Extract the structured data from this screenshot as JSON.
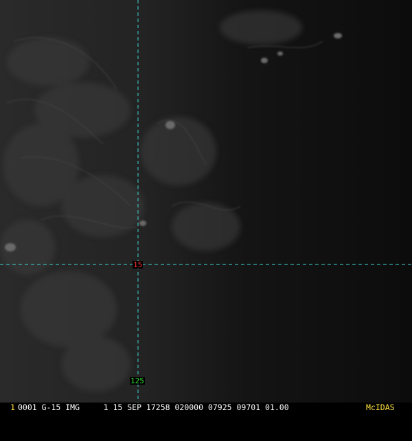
{
  "colors": {
    "background": "#000000",
    "graticule": "#3fd4d4",
    "latitude_label": "#ff3030",
    "longitude_label": "#30e030",
    "frame_number": "#ffe040",
    "status_text": "#ffffff",
    "brand": "#ffe040"
  },
  "graticule": {
    "latitude_label": "15",
    "longitude_label": "125"
  },
  "status_bar": {
    "frame_number": "1",
    "text": "0001 G-15 IMG     1 15 SEP 17258 020000 07925 09701 01.00",
    "brand": "McIDAS"
  }
}
